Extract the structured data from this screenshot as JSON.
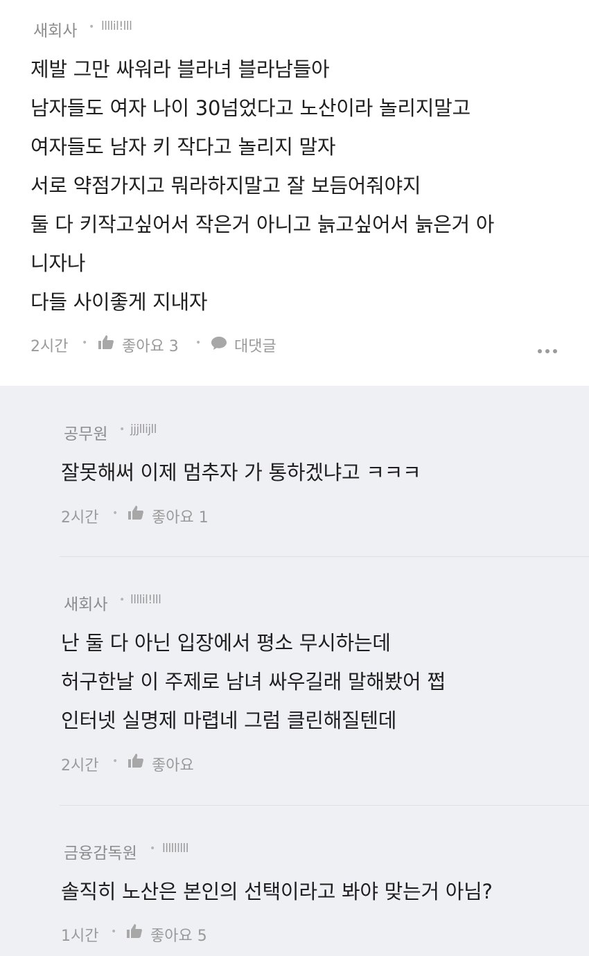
{
  "top_comment": {
    "author": "새회사",
    "user_id": "llllil!lll",
    "lines": [
      "제발 그만 싸워라 블라녀 블라남들아",
      "남자들도 여자 나이 30넘었다고 노산이라 놀리지말고",
      "여자들도 남자 키 작다고 놀리지 말자",
      "서로 약점가지고 뭐라하지말고 잘 보듬어줘야지",
      "둘 다 키작고싶어서 작은거 아니고 늙고싶어서 늙은거 아",
      "니자나",
      "다들 사이좋게 지내자"
    ],
    "time": "2시간",
    "like_label": "좋아요 3",
    "reply_label": "대댓글"
  },
  "replies": [
    {
      "author": "공무원",
      "user_id": "jjjllijll",
      "lines": [
        "잘못해써 이제 멈추자 가 통하겠냐고 ㅋㅋㅋ"
      ],
      "time": "2시간",
      "like_label": "좋아요 1"
    },
    {
      "author": "새회사",
      "user_id": "llllil!lll",
      "lines": [
        "난 둘 다 아닌 입장에서 평소 무시하는데",
        "허구한날 이 주제로 남녀 싸우길래 말해봤어 쩝",
        "인터넷 실명제 마렵네 그럼 클린해질텐데"
      ],
      "time": "2시간",
      "like_label": "좋아요"
    },
    {
      "author": "금융감독원",
      "user_id": "lllllllll",
      "lines": [
        "솔직히 노산은 본인의 선택이라고 봐야 맞는거 아님?"
      ],
      "time": "1시간",
      "like_label": "좋아요 5"
    }
  ],
  "icons": {
    "like": "thumbs-up-icon",
    "reply": "speech-bubble-icon",
    "more": "more-dots-icon"
  },
  "colors": {
    "reply_background": "#eef0f3",
    "meta_text": "#9a9a9a"
  }
}
